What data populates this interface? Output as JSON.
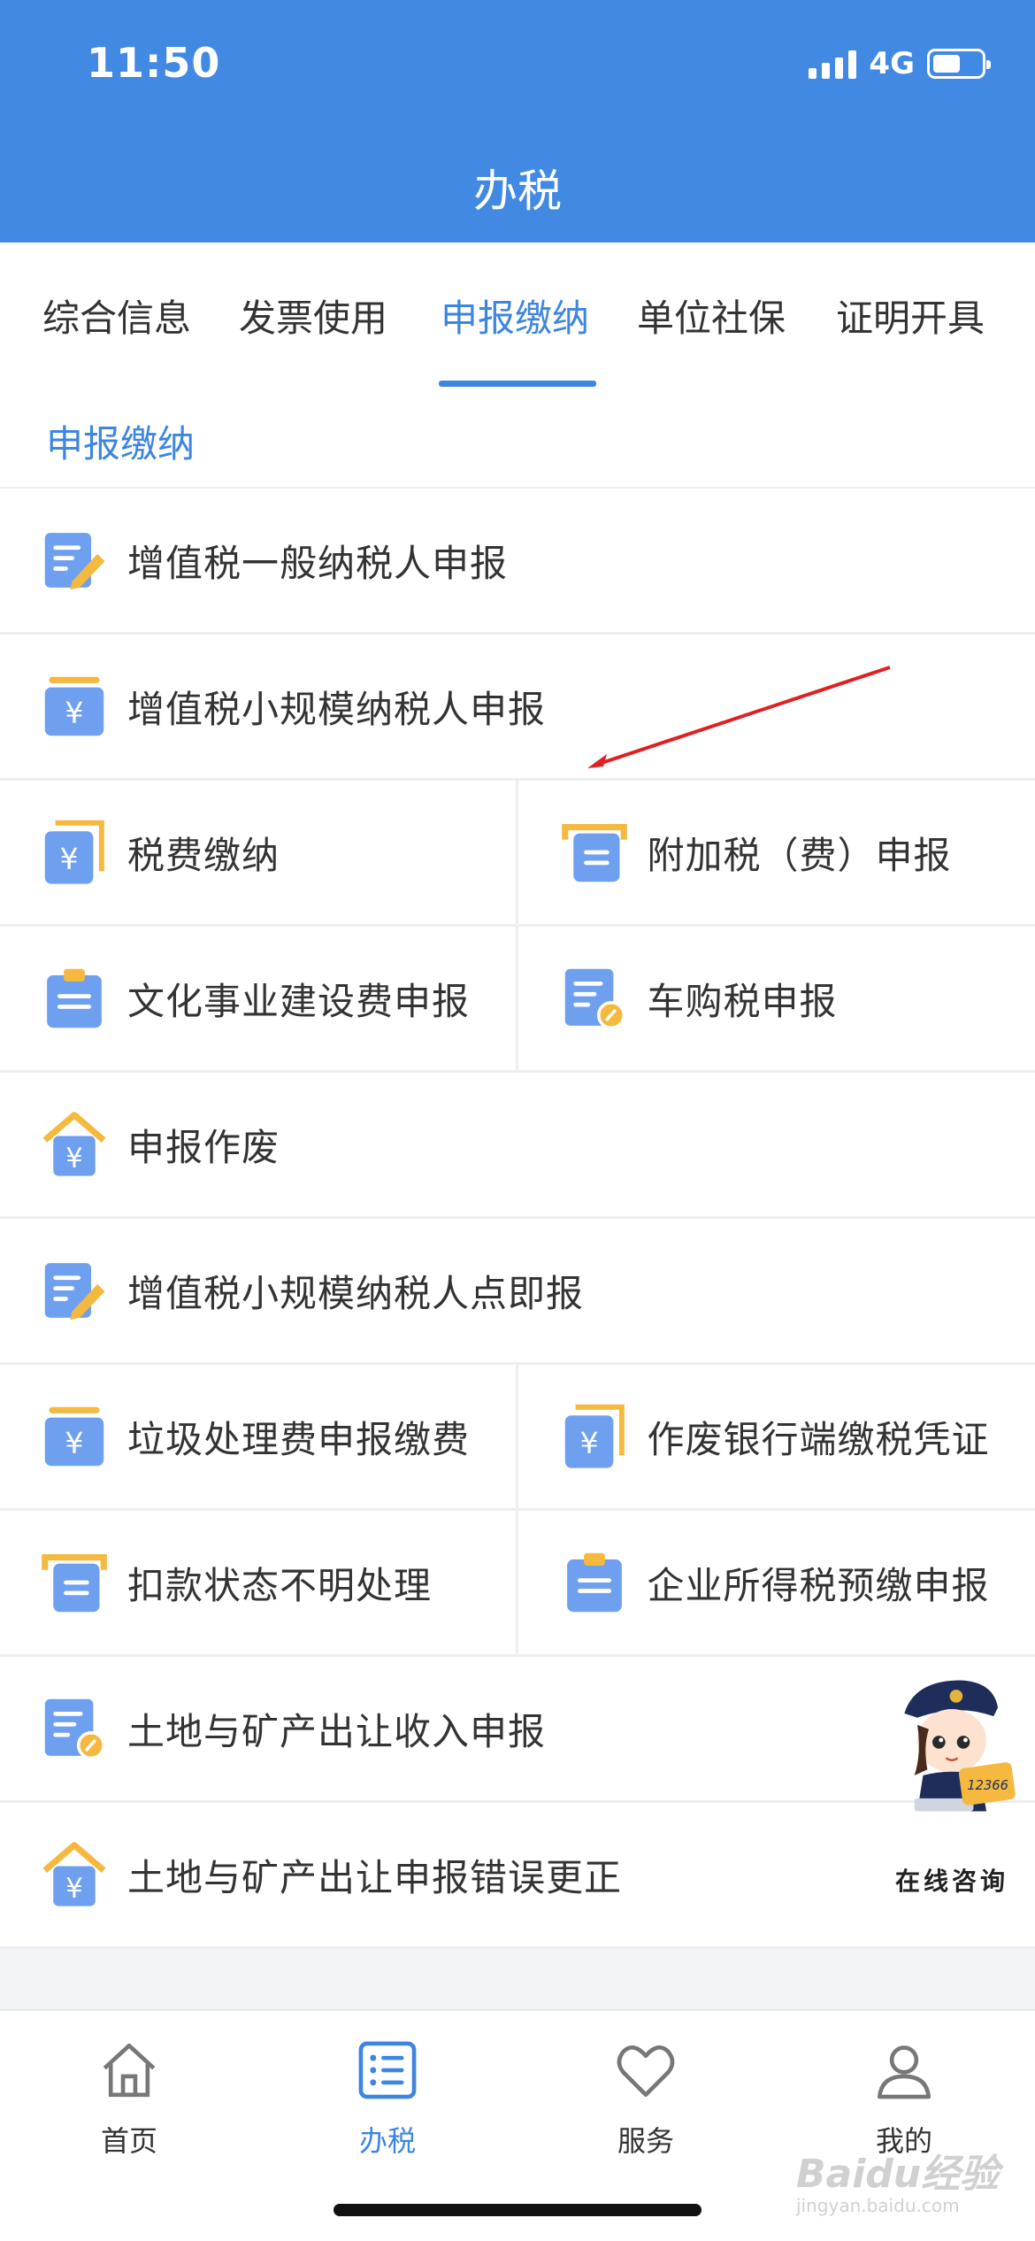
{
  "status": {
    "time": "11:50",
    "network": "4G"
  },
  "header": {
    "title": "办税"
  },
  "tabs": [
    {
      "label": "综合信息"
    },
    {
      "label": "发票使用"
    },
    {
      "label": "申报缴纳"
    },
    {
      "label": "单位社保"
    },
    {
      "label": "证明开具"
    }
  ],
  "section": {
    "title": "申报缴纳"
  },
  "items": {
    "vat_general": {
      "label": "增值税一般纳税人申报",
      "icon": "edit-form-icon"
    },
    "vat_small": {
      "label": "增值税小规模纳税人申报",
      "icon": "yuan-card-icon"
    },
    "tax_payment": {
      "label": "税费缴纳",
      "icon": "yuan-wallet-icon"
    },
    "surtax": {
      "label": "附加税（费）申报",
      "icon": "folder-doc-icon"
    },
    "culture_fee": {
      "label": "文化事业建设费申报",
      "icon": "clipboard-icon"
    },
    "vehicle_tax": {
      "label": "车购税申报",
      "icon": "doc-pen-icon"
    },
    "void_declaration": {
      "label": "申报作废",
      "icon": "yuan-house-icon"
    },
    "vat_small_instant": {
      "label": "增值税小规模纳税人点即报",
      "icon": "edit-form-icon"
    },
    "garbage_fee": {
      "label": "垃圾处理费申报缴费",
      "icon": "yuan-card-icon"
    },
    "void_bank_voucher": {
      "label": "作废银行端缴税凭证",
      "icon": "yuan-wallet-icon"
    },
    "deduction_unknown": {
      "label": "扣款状态不明处理",
      "icon": "folder-doc-icon"
    },
    "corp_income_prepay": {
      "label": "企业所得税预缴申报",
      "icon": "clipboard-icon"
    },
    "land_mineral": {
      "label": "土地与矿产出让收入申报",
      "icon": "doc-pen-icon"
    },
    "land_mineral_fix": {
      "label": "土地与矿产出让申报错误更正",
      "icon": "yuan-house-icon"
    }
  },
  "assistant": {
    "label": "在线咨询",
    "hotline": "12366"
  },
  "bottom_nav": [
    {
      "label": "首页",
      "icon": "home-icon"
    },
    {
      "label": "办税",
      "icon": "list-icon"
    },
    {
      "label": "服务",
      "icon": "heart-icon"
    },
    {
      "label": "我的",
      "icon": "user-icon"
    }
  ],
  "watermark": {
    "brand": "Baidu经验",
    "url": "jingyan.baidu.com"
  },
  "colors": {
    "primary": "#4189e2",
    "active": "#3e85e0",
    "icon_blue": "#6fa0f0",
    "icon_yellow": "#f4b93e",
    "annotation_arrow": "#e02020"
  }
}
